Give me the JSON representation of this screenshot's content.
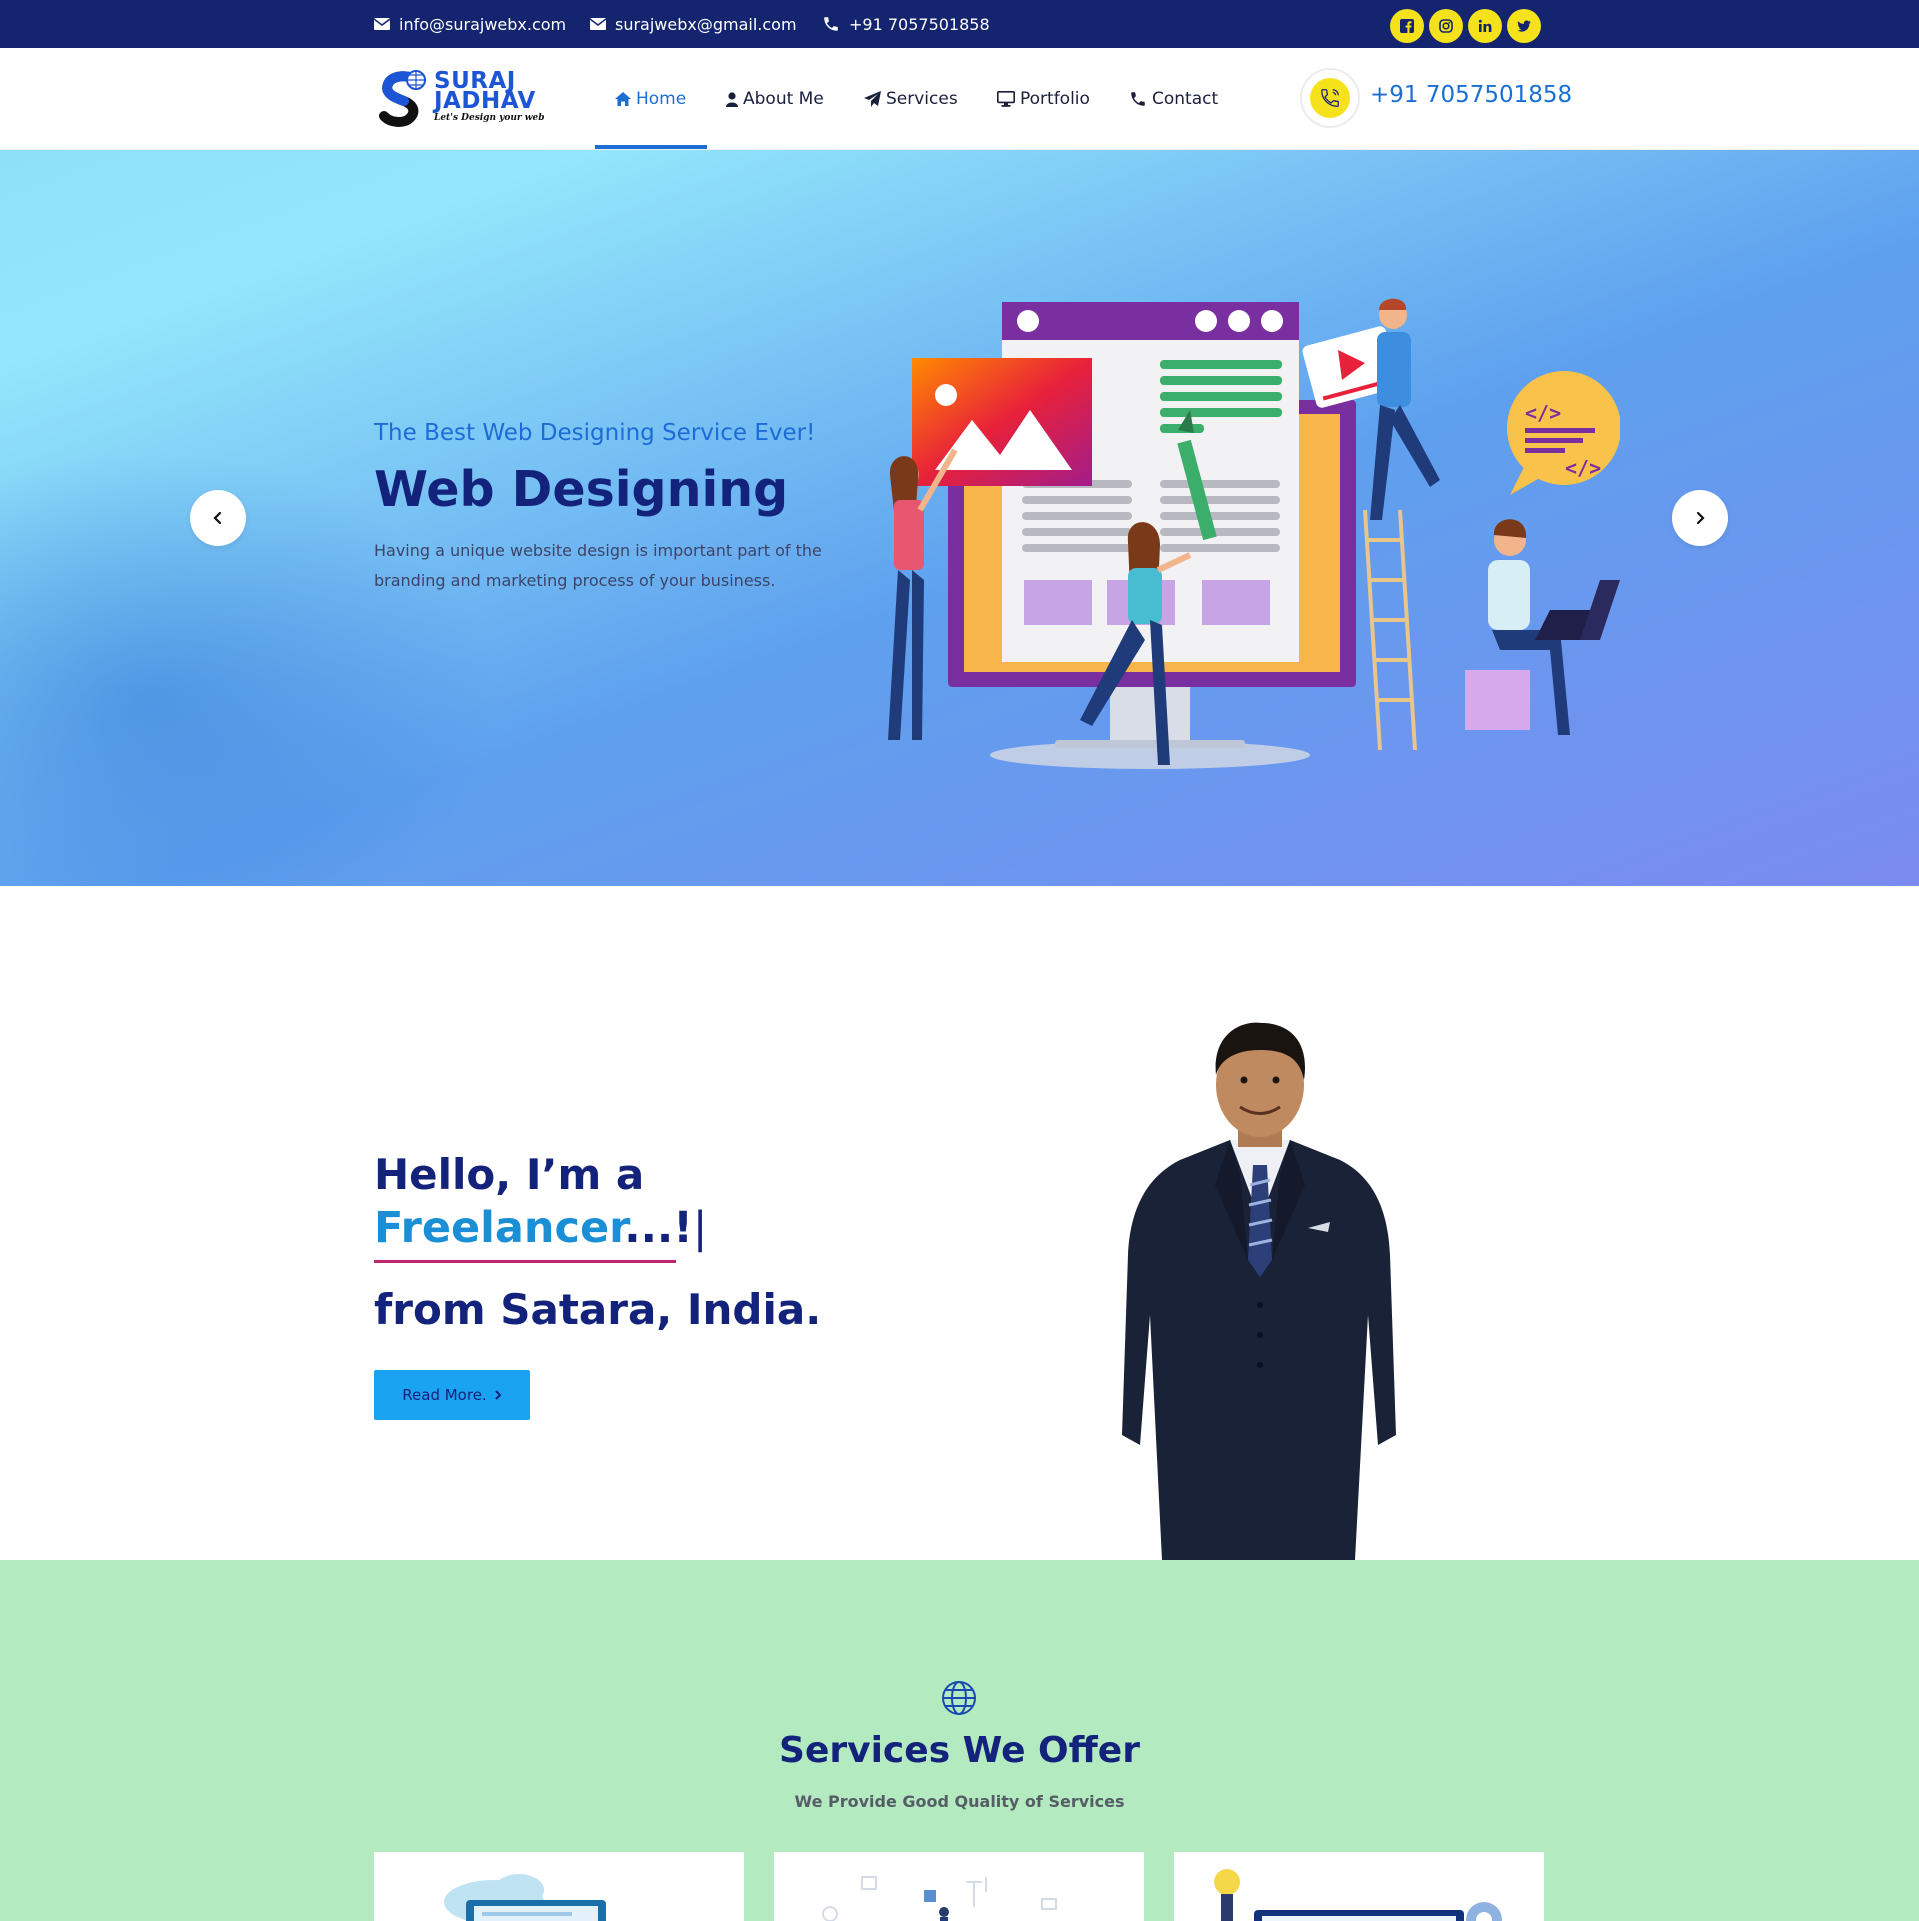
{
  "topbar": {
    "email1": "info@surajwebx.com",
    "email2": "surajwebx@gmail.com",
    "phone": "+91 7057501858",
    "social": [
      "facebook-icon",
      "instagram-icon",
      "linkedin-icon",
      "twitter-icon"
    ]
  },
  "logo": {
    "line1": "SURAJ",
    "line2": "JADHAV",
    "tagline": "Let's Design your web"
  },
  "nav": {
    "items": [
      {
        "label": "Home",
        "icon": "home-icon",
        "active": true
      },
      {
        "label": "About Me",
        "icon": "user-icon"
      },
      {
        "label": "Services",
        "icon": "paper-plane-icon"
      },
      {
        "label": "Portfolio",
        "icon": "desktop-icon"
      },
      {
        "label": "Contact",
        "icon": "phone-icon"
      }
    ],
    "phone": "+91 7057501858"
  },
  "hero": {
    "subtitle": "The Best Web Designing Service Ever!",
    "title": "Web Designing",
    "text": "Having a unique website design is important part of the branding and marketing process of your business."
  },
  "about": {
    "greeting": "Hello, I’m a",
    "role_highlight": "Freelancer",
    "role_rest": "...!",
    "caret": "|",
    "location": "from Satara, India.",
    "button": "Read More."
  },
  "services": {
    "title": "Services We Offer",
    "subtitle": "We Provide Good Quality of Services"
  },
  "colors": {
    "topbar": "#14246e",
    "accent": "#1a6fd6",
    "navy": "#13227a",
    "yellow": "#f5e21b",
    "button": "#1aa3f0",
    "services_bg": "#b4eac0",
    "underline": "#c0256e"
  }
}
